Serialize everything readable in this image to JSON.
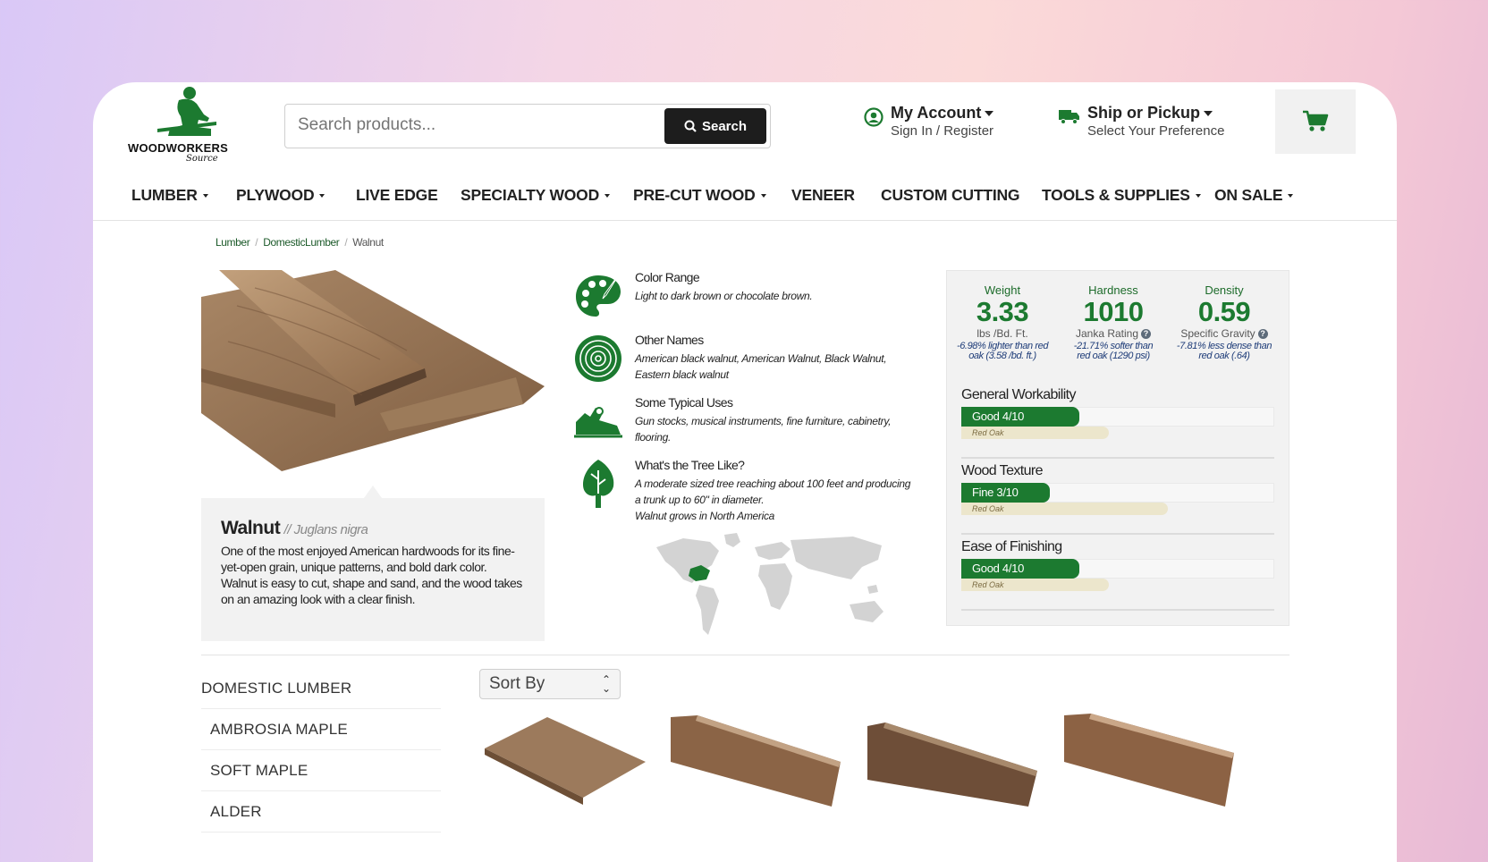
{
  "header": {
    "brand": "WOODWORKERS",
    "brand_sub": "Source",
    "search_placeholder": "Search products...",
    "search_button": "Search",
    "account_title": "My Account",
    "account_sub": "Sign In / Register",
    "ship_title": "Ship or Pickup",
    "ship_sub": "Select Your Preference"
  },
  "nav": [
    {
      "label": "LUMBER",
      "dropdown": true
    },
    {
      "label": "PLYWOOD",
      "dropdown": true
    },
    {
      "label": "LIVE EDGE",
      "dropdown": false
    },
    {
      "label": "SPECIALTY WOOD",
      "dropdown": true
    },
    {
      "label": "PRE-CUT WOOD",
      "dropdown": true
    },
    {
      "label": "VENEER",
      "dropdown": false
    },
    {
      "label": "CUSTOM CUTTING",
      "dropdown": false
    },
    {
      "label": "TOOLS & SUPPLIES",
      "dropdown": true
    },
    {
      "label": "ON SALE",
      "dropdown": true
    }
  ],
  "breadcrumb": [
    "Lumber",
    "DomesticLumber",
    "Walnut"
  ],
  "product": {
    "name": "Walnut",
    "latin": "// Juglans nigra",
    "description": "One of the most enjoyed American hardwoods for its fine-yet-open grain, unique patterns, and bold dark color. Walnut is easy to cut, shape and sand, and the wood takes on an amazing look with a clear finish."
  },
  "features": [
    {
      "title": "Color Range",
      "body": "Light to dark brown or chocolate brown.",
      "icon": "palette-icon"
    },
    {
      "title": "Other Names",
      "body": "American black walnut, American Walnut, Black Walnut, Eastern black walnut",
      "icon": "tree-rings-icon"
    },
    {
      "title": "Some Typical Uses",
      "body": "Gun stocks, musical instruments, fine furniture, cabinetry, flooring.",
      "icon": "hand-plane-icon"
    },
    {
      "title": "What's the Tree Like?",
      "body": "A moderate sized tree reaching about 100 feet and producing a trunk up to 60\" in diameter.",
      "body2": "Walnut grows in North America",
      "icon": "tree-icon"
    }
  ],
  "stats": [
    {
      "label": "Weight",
      "value": "3.33",
      "unit": "lbs /Bd. Ft.",
      "help": false,
      "cmp1": "-6.98% lighter than red",
      "cmp2": "oak (3.58 /bd. ft.)"
    },
    {
      "label": "Hardness",
      "value": "1010",
      "unit": "Janka Rating",
      "help": true,
      "cmp1": "-21.71% softer than",
      "cmp2": "red oak (1290 psi)"
    },
    {
      "label": "Density",
      "value": "0.59",
      "unit": "Specific Gravity",
      "help": true,
      "cmp1": "-7.81% less dense than",
      "cmp2": "red oak (.64)"
    }
  ],
  "bars": [
    {
      "title": "General Workability",
      "label": "Good 4/10",
      "level": 0.4,
      "ref_label": "Red Oak",
      "ref_level": 0.5
    },
    {
      "title": "Wood Texture",
      "label": "Fine 3/10",
      "level": 0.3,
      "ref_label": "Red Oak",
      "ref_level": 0.7
    },
    {
      "title": "Ease of Finishing",
      "label": "Good 4/10",
      "level": 0.4,
      "ref_label": "Red Oak",
      "ref_level": 0.5
    }
  ],
  "sidebar": [
    "DOMESTIC LUMBER",
    "AMBROSIA MAPLE",
    "SOFT MAPLE",
    "ALDER"
  ],
  "sort_label": "Sort By",
  "colors": {
    "accent": "#1c7a30",
    "dark_button": "#1d1d1d",
    "panel": "#f2f2f2"
  }
}
